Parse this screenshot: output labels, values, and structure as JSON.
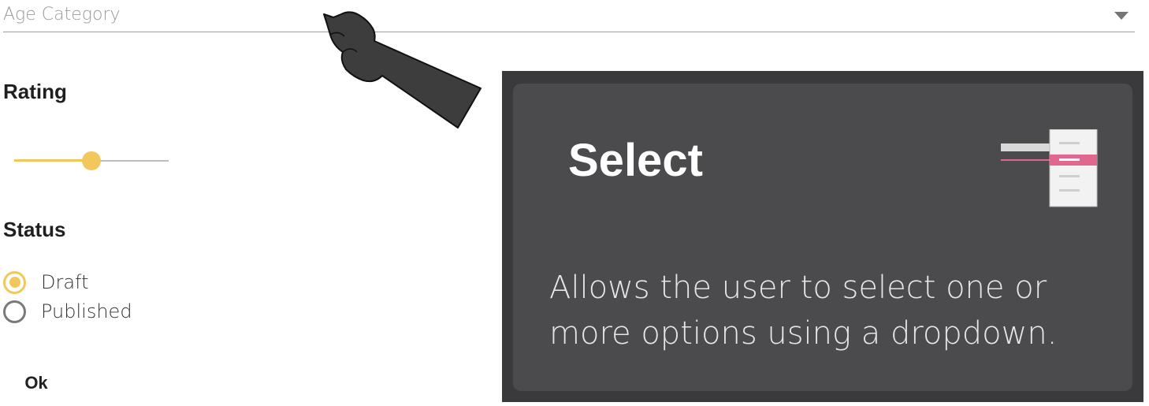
{
  "form": {
    "age_select": {
      "placeholder": "Age Category",
      "icon": "dropdown-arrow-icon"
    },
    "rating": {
      "label": "Rating",
      "value_fraction": 0.5
    },
    "status": {
      "label": "Status",
      "options": [
        {
          "label": "Draft",
          "checked": true
        },
        {
          "label": "Published",
          "checked": false
        }
      ]
    },
    "ok_label": "Ok"
  },
  "tooltip": {
    "title": "Select",
    "description": "Allows the user to select one or more options using a dropdown.",
    "illustration": "select-dropdown-icon"
  },
  "colors": {
    "accent": "#f2c75c",
    "panel_bg": "#3a393b",
    "card_bg": "#4b4a4d",
    "highlight": "#e0688f"
  }
}
